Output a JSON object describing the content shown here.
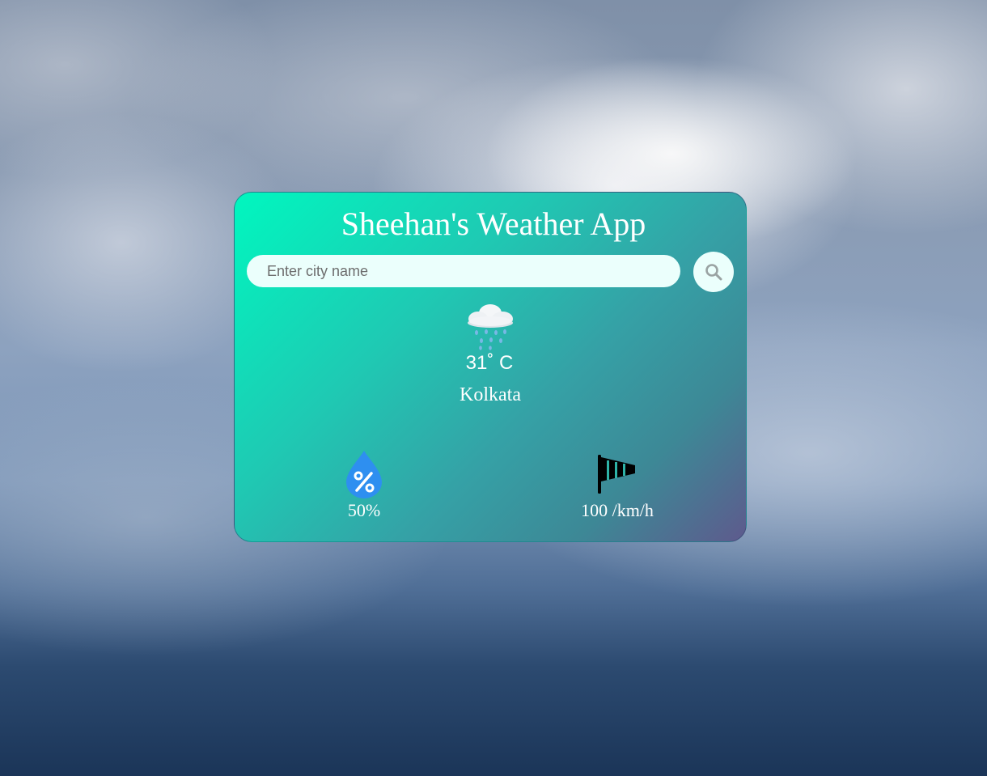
{
  "app": {
    "title": "Sheehan's Weather App"
  },
  "search": {
    "placeholder": "Enter city name",
    "value": "",
    "button_icon": "search-icon"
  },
  "current": {
    "condition_icon": "rain-cloud-icon",
    "temperature": "31˚ C",
    "city": "Kolkata"
  },
  "details": {
    "humidity": {
      "icon": "humidity-drop-icon",
      "value": "50%"
    },
    "wind": {
      "icon": "windsock-icon",
      "value": "100 /km/h"
    }
  },
  "colors": {
    "card_gradient_start": "#00f7bf",
    "card_gradient_end": "#5e5a8d",
    "input_background": "#ebfffc",
    "humidity_icon": "#2e8ff0",
    "text": "#ffffff"
  }
}
